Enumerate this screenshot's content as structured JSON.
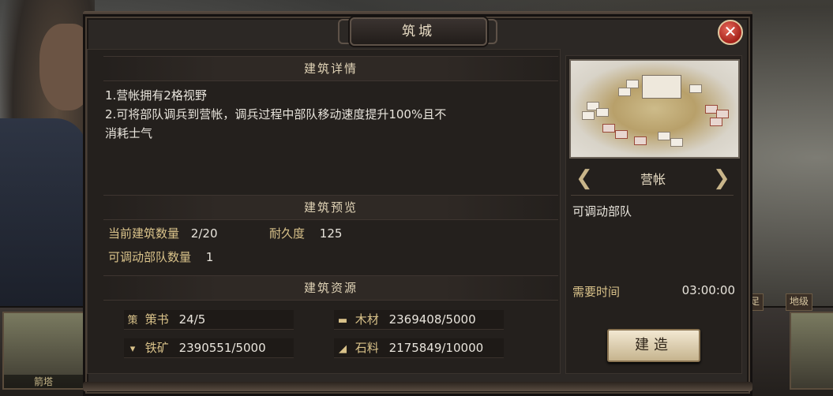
{
  "dialog": {
    "title": "筑城",
    "close_icon": "close-icon"
  },
  "details": {
    "header": "建筑详情",
    "line1": "1.营帐拥有2格视野",
    "line2": "2.可将部队调兵到营帐，调兵过程中部队移动速度提升100%且不",
    "line3": "消耗士气"
  },
  "preview": {
    "header": "建筑预览",
    "count_label": "当前建筑数量",
    "count_value": "2/20",
    "durability_label": "耐久度",
    "durability_value": "125",
    "troops_label": "可调动部队数量",
    "troops_value": "1"
  },
  "resources": {
    "header": "建筑资源",
    "items": [
      {
        "icon": "book-icon",
        "glyph": "策",
        "label": "策书",
        "value": "24/5"
      },
      {
        "icon": "wood-icon",
        "glyph": "▬",
        "label": "木材",
        "value": "2369408/5000"
      },
      {
        "icon": "iron-icon",
        "glyph": "▾",
        "label": "铁矿",
        "value": "2390551/5000"
      },
      {
        "icon": "stone-icon",
        "glyph": "◢",
        "label": "石料",
        "value": "2175849/10000"
      }
    ]
  },
  "building": {
    "name": "营帐",
    "description": "可调动部队",
    "time_label": "需要时间",
    "time_value": "03:00:00",
    "build_label": "建造"
  },
  "background": {
    "left_card_label": "箭塔",
    "right_tab_1": "足",
    "right_tab_2": "地级"
  },
  "colors": {
    "gold_text": "#d9c28a",
    "panel_bg": "#24201d",
    "close_red": "#a5211a"
  }
}
